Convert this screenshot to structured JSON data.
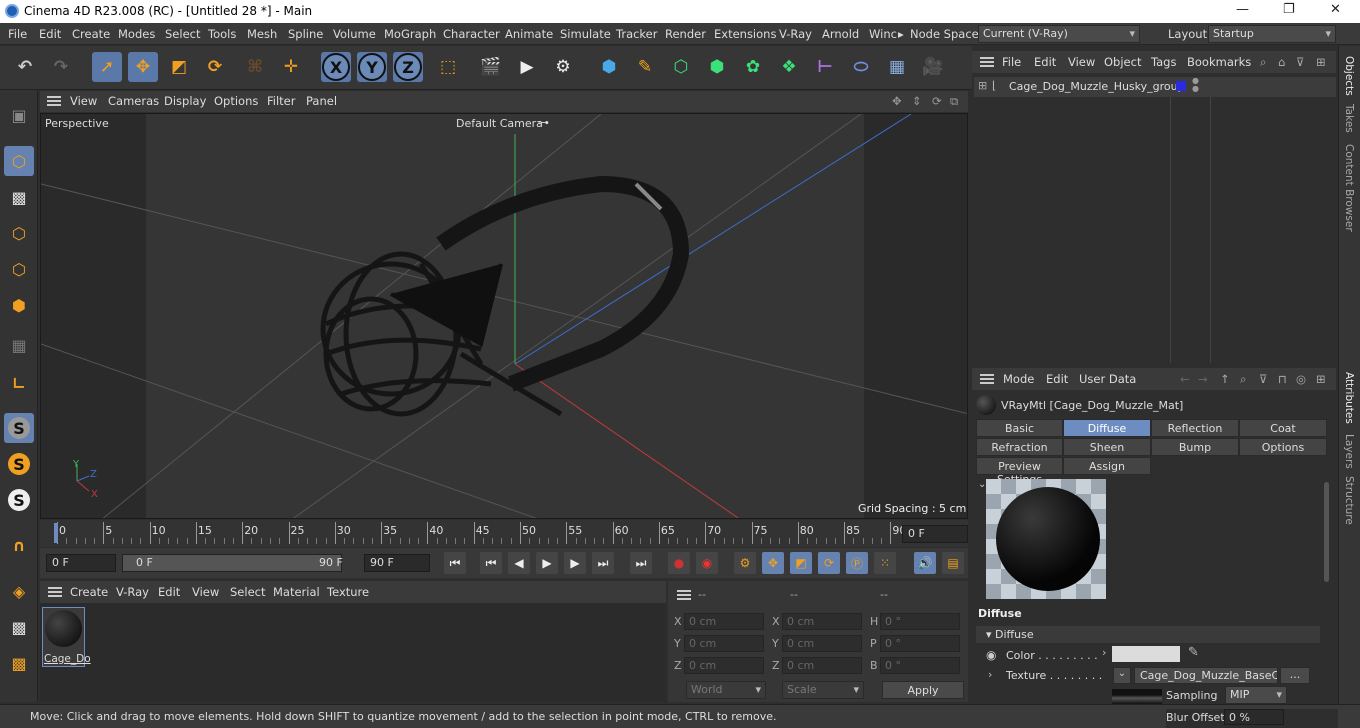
{
  "window": {
    "title": "Cinema 4D R23.008 (RC) - [Untitled 28 *] - Main",
    "min": "—",
    "max": "❐",
    "close": "✕"
  },
  "menubar": {
    "items": [
      "File",
      "Edit",
      "Create",
      "Modes",
      "Select",
      "Tools",
      "Mesh",
      "Spline",
      "Volume",
      "MoGraph",
      "Character",
      "Animate",
      "Simulate",
      "Tracker",
      "Render",
      "Extensions",
      "V-Ray",
      "Arnold",
      "Winc"
    ],
    "overflow": "▸",
    "node_space_label": "Node Space:",
    "node_space_value": "Current (V-Ray)",
    "layout_label": "Layout:",
    "layout_value": "Startup"
  },
  "toolbar": {
    "x": "X",
    "y": "Y",
    "z": "Z"
  },
  "viewport": {
    "menu": [
      "View",
      "Cameras",
      "Display",
      "Options",
      "Filter",
      "Panel"
    ],
    "projection": "Perspective",
    "camera": "Default Camera",
    "camera_icon": "⊶",
    "grid_spacing": "Grid Spacing : 5 cm",
    "axis_x": "X",
    "axis_y": "Y",
    "axis_z": "Z"
  },
  "timeline": {
    "ticks": [
      "0",
      "5",
      "10",
      "15",
      "20",
      "25",
      "30",
      "35",
      "40",
      "45",
      "50",
      "55",
      "60",
      "65",
      "70",
      "75",
      "80",
      "85",
      "90"
    ],
    "current": "0 F"
  },
  "playbar": {
    "start": "0 F",
    "range_start": "0 F",
    "range_end": "90 F",
    "end": "90 F"
  },
  "material_manager": {
    "menu": [
      "Create",
      "V-Ray",
      "Edit",
      "View",
      "Select",
      "Material",
      "Texture"
    ],
    "materials": [
      {
        "name": "Cage_Do"
      }
    ]
  },
  "coords": {
    "headers": [
      "--",
      "--",
      "--"
    ],
    "rows": [
      {
        "l1": "X",
        "v1": "0 cm",
        "l2": "X",
        "v2": "0 cm",
        "l3": "H",
        "v3": "0 °"
      },
      {
        "l1": "Y",
        "v1": "0 cm",
        "l2": "Y",
        "v2": "0 cm",
        "l3": "P",
        "v3": "0 °"
      },
      {
        "l1": "Z",
        "v1": "0 cm",
        "l2": "Z",
        "v2": "0 cm",
        "l3": "B",
        "v3": "0 °"
      }
    ],
    "mode": "World",
    "scale": "Scale",
    "apply": "Apply"
  },
  "objects": {
    "menu": [
      "File",
      "Edit",
      "View",
      "Object",
      "Tags",
      "Bookmarks"
    ],
    "items": [
      {
        "name": "Cage_Dog_Muzzle_Husky_group"
      }
    ]
  },
  "attributes": {
    "menu": [
      "Mode",
      "Edit",
      "User Data"
    ],
    "material_title": "VRayMtl [Cage_Dog_Muzzle_Mat]",
    "tabs_row1": [
      "Basic",
      "Diffuse",
      "Reflection",
      "Coat"
    ],
    "tabs_row2": [
      "Refraction",
      "Sheen",
      "Bump",
      "Options"
    ],
    "tabs_row3": [
      "Preview Settings",
      "Assign"
    ],
    "section": "Diffuse",
    "group": "Diffuse",
    "color_label": "Color . . . . . . . . .",
    "texture_label": "Texture . . . . . . . .",
    "texture_value": "Cage_Dog_Muzzle_BaseCol",
    "more": "...",
    "sampling_label": "Sampling",
    "sampling_value": "MIP",
    "blur_label": "Blur Offset",
    "blur_value": "0 %"
  },
  "side_tabs": [
    "Objects",
    "Takes",
    "Content Browser",
    "Attributes",
    "Layers",
    "Structure"
  ],
  "status": {
    "text": "Move: Click and drag to move elements. Hold down SHIFT to quantize movement / add to the selection in point mode, CTRL to remove."
  }
}
